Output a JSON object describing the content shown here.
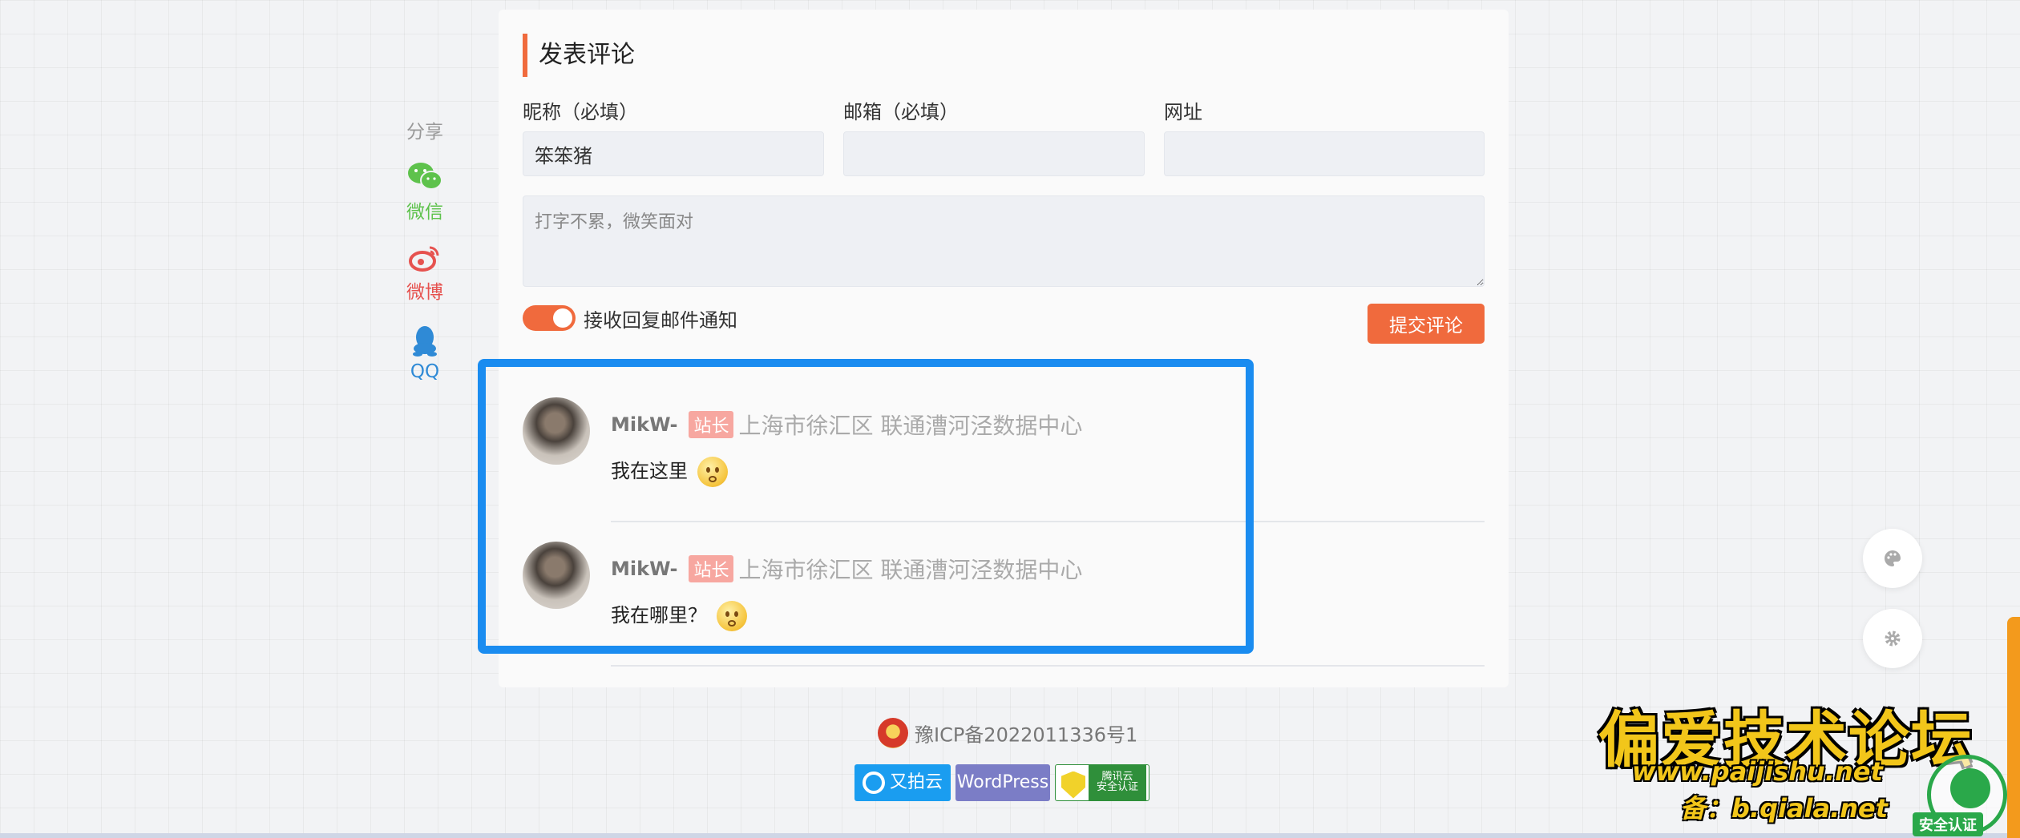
{
  "share": {
    "title": "分享",
    "items": [
      {
        "label": "微信",
        "icon": "wechat-icon"
      },
      {
        "label": "微博",
        "icon": "weibo-icon"
      },
      {
        "label": "QQ",
        "icon": "qq-icon"
      }
    ]
  },
  "form": {
    "heading": "发表评论",
    "nickname_label": "昵称（必填）",
    "nickname_value": "笨笨猪",
    "email_label": "邮箱（必填）",
    "email_value": "",
    "url_label": "网址",
    "url_value": "",
    "comment_placeholder": "打字不累，微笑面对",
    "notify_label": "接收回复邮件通知",
    "notify_on": true,
    "submit_label": "提交评论"
  },
  "comments": [
    {
      "author": "MikW-",
      "badge": "站长",
      "location": "上海市徐汇区 联通漕河泾数据中心",
      "text": "我在这里",
      "emoji": "thinking-emoji"
    },
    {
      "author": "MikW-",
      "badge": "站长",
      "location": "上海市徐汇区 联通漕河泾数据中心",
      "text": "我在哪里？",
      "emoji": "confused-emoji"
    }
  ],
  "footer": {
    "icp": "豫ICP备2022011336号1",
    "badges": [
      "又拍云",
      "WordPress",
      "腾讯云",
      "安全认证"
    ]
  },
  "watermark": {
    "title": "偏爱技术论坛",
    "url": "www.paijishu.net",
    "bak": "备：b.qiala.net",
    "ssl_label": "安全认证"
  },
  "colors": {
    "accent": "#f06a3d",
    "highlight": "#1a8cf0",
    "wechat": "#5ec24c",
    "weibo": "#e6524f",
    "qq": "#2f8ad6"
  }
}
